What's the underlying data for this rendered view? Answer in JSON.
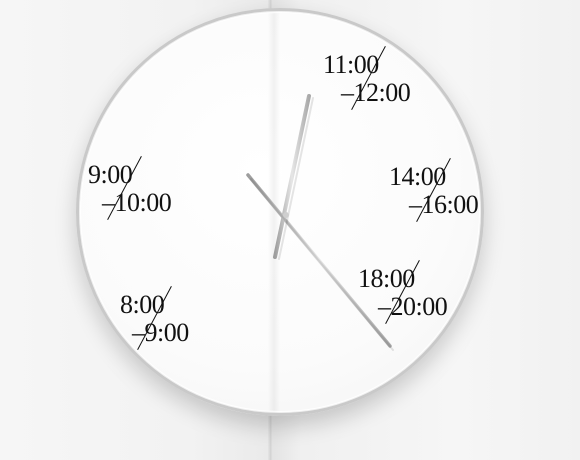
{
  "clock": {
    "labels": [
      {
        "start": "11:00",
        "end": "–12:00"
      },
      {
        "start": "9:00",
        "end": "–10:00"
      },
      {
        "start": "14:00",
        "end": "–16:00"
      },
      {
        "start": "8:00",
        "end": "–9:00"
      },
      {
        "start": "18:00",
        "end": "–20:00"
      }
    ],
    "colors": {
      "background": "#f3f3f3",
      "face": "#ffffff",
      "rim": "#c9c9c9",
      "text": "#111111",
      "hand": "#bdbdbd"
    }
  }
}
